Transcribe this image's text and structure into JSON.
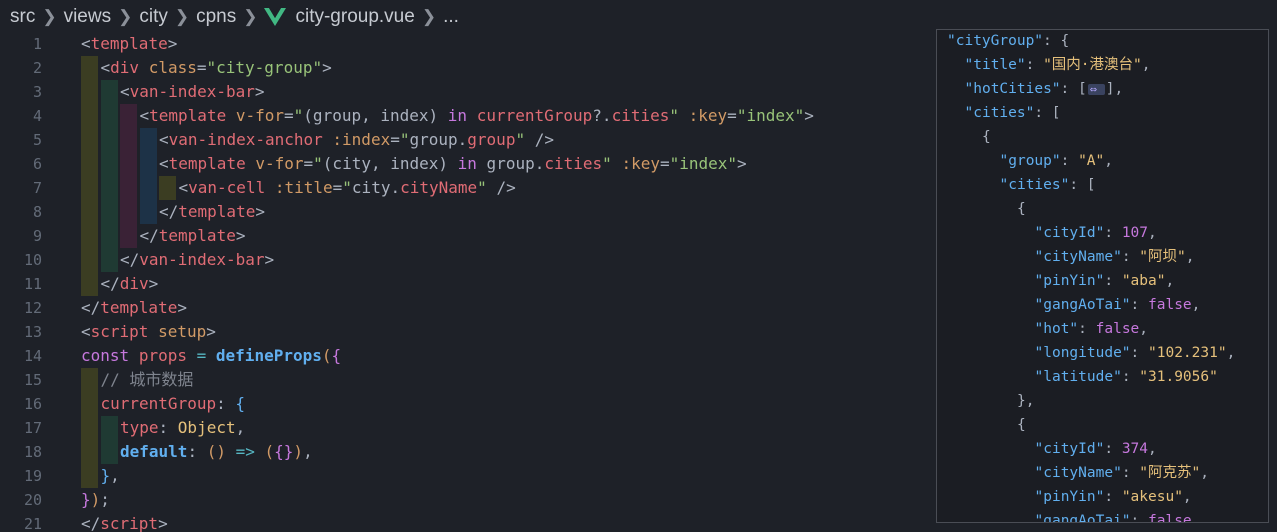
{
  "breadcrumb": {
    "items": [
      "src",
      "views",
      "city",
      "cpns"
    ],
    "file": "city-group.vue",
    "trail": "..."
  },
  "colors": {
    "vue_green": "#41b883",
    "background": "#1e2128"
  },
  "editor": {
    "lines": [
      {
        "n": "1",
        "indent": 0,
        "tokens": [
          [
            "br",
            "<"
          ],
          [
            "tag",
            "template"
          ],
          [
            "br",
            ">"
          ]
        ]
      },
      {
        "n": "2",
        "indent": 1,
        "tokens": [
          [
            "br",
            "<"
          ],
          [
            "tag",
            "div"
          ],
          [
            "plain",
            " "
          ],
          [
            "attr",
            "class"
          ],
          [
            "br",
            "="
          ],
          [
            "str",
            "\"city-group\""
          ],
          [
            "br",
            ">"
          ]
        ]
      },
      {
        "n": "3",
        "indent": 2,
        "tokens": [
          [
            "br",
            "<"
          ],
          [
            "tag",
            "van-index-bar"
          ],
          [
            "br",
            ">"
          ]
        ]
      },
      {
        "n": "4",
        "indent": 3,
        "tokens": [
          [
            "br",
            "<"
          ],
          [
            "tag",
            "template"
          ],
          [
            "plain",
            " "
          ],
          [
            "attr",
            "v-for"
          ],
          [
            "br",
            "="
          ],
          [
            "str",
            "\""
          ],
          [
            "plain",
            "(group, index) "
          ],
          [
            "key",
            "in"
          ],
          [
            "plain",
            " "
          ],
          [
            "var",
            "currentGroup"
          ],
          [
            "plain",
            "?."
          ],
          [
            "var",
            "cities"
          ],
          [
            "str",
            "\""
          ],
          [
            "plain",
            " "
          ],
          [
            "attr",
            ":key"
          ],
          [
            "br",
            "="
          ],
          [
            "str",
            "\"index\""
          ],
          [
            "br",
            ">"
          ]
        ]
      },
      {
        "n": "5",
        "indent": 4,
        "tokens": [
          [
            "br",
            "<"
          ],
          [
            "tag",
            "van-index-anchor"
          ],
          [
            "plain",
            " "
          ],
          [
            "attr",
            ":index"
          ],
          [
            "br",
            "="
          ],
          [
            "str",
            "\""
          ],
          [
            "plain",
            "group."
          ],
          [
            "var",
            "group"
          ],
          [
            "str",
            "\""
          ],
          [
            "plain",
            " "
          ],
          [
            "br",
            "/>"
          ]
        ]
      },
      {
        "n": "6",
        "indent": 4,
        "tokens": [
          [
            "br",
            "<"
          ],
          [
            "tag",
            "template"
          ],
          [
            "plain",
            " "
          ],
          [
            "attr",
            "v-for"
          ],
          [
            "br",
            "="
          ],
          [
            "str",
            "\""
          ],
          [
            "plain",
            "(city, index) "
          ],
          [
            "key",
            "in"
          ],
          [
            "plain",
            " group."
          ],
          [
            "var",
            "cities"
          ],
          [
            "str",
            "\""
          ],
          [
            "plain",
            " "
          ],
          [
            "attr",
            ":key"
          ],
          [
            "br",
            "="
          ],
          [
            "str",
            "\"index\""
          ],
          [
            "br",
            ">"
          ]
        ]
      },
      {
        "n": "7",
        "indent": 5,
        "tokens": [
          [
            "br",
            "<"
          ],
          [
            "tag",
            "van-cell"
          ],
          [
            "plain",
            " "
          ],
          [
            "attr",
            ":title"
          ],
          [
            "br",
            "="
          ],
          [
            "str",
            "\""
          ],
          [
            "plain",
            "city."
          ],
          [
            "var",
            "cityName"
          ],
          [
            "str",
            "\""
          ],
          [
            "plain",
            " "
          ],
          [
            "br",
            "/>"
          ]
        ]
      },
      {
        "n": "8",
        "indent": 4,
        "tokens": [
          [
            "br",
            "</"
          ],
          [
            "tag",
            "template"
          ],
          [
            "br",
            ">"
          ]
        ]
      },
      {
        "n": "9",
        "indent": 3,
        "tokens": [
          [
            "br",
            "</"
          ],
          [
            "tag",
            "template"
          ],
          [
            "br",
            ">"
          ]
        ]
      },
      {
        "n": "10",
        "indent": 2,
        "tokens": [
          [
            "br",
            "</"
          ],
          [
            "tag",
            "van-index-bar"
          ],
          [
            "br",
            ">"
          ]
        ]
      },
      {
        "n": "11",
        "indent": 1,
        "tokens": [
          [
            "br",
            "</"
          ],
          [
            "tag",
            "div"
          ],
          [
            "br",
            ">"
          ]
        ]
      },
      {
        "n": "12",
        "indent": 0,
        "tokens": [
          [
            "br",
            "</"
          ],
          [
            "tag",
            "template"
          ],
          [
            "br",
            ">"
          ]
        ]
      },
      {
        "n": "13",
        "indent": 0,
        "tokens": [
          [
            "br",
            "<"
          ],
          [
            "tag",
            "script"
          ],
          [
            "plain",
            " "
          ],
          [
            "attr",
            "setup"
          ],
          [
            "br",
            ">"
          ]
        ]
      },
      {
        "n": "14",
        "indent": 0,
        "tokens": [
          [
            "key",
            "const"
          ],
          [
            "plain",
            " "
          ],
          [
            "var",
            "props"
          ],
          [
            "plain",
            " "
          ],
          [
            "op",
            "="
          ],
          [
            "plain",
            " "
          ],
          [
            "fn",
            "defineProps"
          ],
          [
            "p1",
            "("
          ],
          [
            "p2",
            "{"
          ]
        ]
      },
      {
        "n": "15",
        "indent": 1,
        "tokens": [
          [
            "com",
            "// 城市数据"
          ]
        ]
      },
      {
        "n": "16",
        "indent": 1,
        "tokens": [
          [
            "prop",
            "currentGroup"
          ],
          [
            "plain",
            ": "
          ],
          [
            "p3",
            "{"
          ]
        ]
      },
      {
        "n": "17",
        "indent": 2,
        "tokens": [
          [
            "prop",
            "type"
          ],
          [
            "plain",
            ": "
          ],
          [
            "type",
            "Object"
          ],
          [
            "plain",
            ","
          ]
        ]
      },
      {
        "n": "18",
        "indent": 2,
        "tokens": [
          [
            "kw2",
            "default"
          ],
          [
            "plain",
            ": "
          ],
          [
            "p1",
            "()"
          ],
          [
            "plain",
            " "
          ],
          [
            "op",
            "=>"
          ],
          [
            "plain",
            " "
          ],
          [
            "p1",
            "("
          ],
          [
            "p2",
            "{}"
          ],
          [
            "p1",
            ")"
          ],
          [
            "plain",
            ","
          ]
        ]
      },
      {
        "n": "19",
        "indent": 1,
        "tokens": [
          [
            "p3",
            "}"
          ],
          [
            "plain",
            ","
          ]
        ]
      },
      {
        "n": "20",
        "indent": 0,
        "tokens": [
          [
            "p2",
            "}"
          ],
          [
            "p1",
            ")"
          ],
          [
            "plain",
            ";"
          ]
        ]
      },
      {
        "n": "21",
        "indent": 0,
        "tokens": [
          [
            "br",
            "</"
          ],
          [
            "tag",
            "script"
          ],
          [
            "br",
            ">"
          ]
        ]
      }
    ]
  },
  "json_panel": {
    "lines": [
      {
        "i": 0,
        "tokens": [
          [
            "key",
            "\"cityGroup\""
          ],
          [
            "pun",
            ": {"
          ]
        ]
      },
      {
        "i": 1,
        "tokens": [
          [
            "key",
            "\"title\""
          ],
          [
            "pun",
            ": "
          ],
          [
            "str",
            "\"国内·港澳台\""
          ],
          [
            "pun",
            ","
          ]
        ]
      },
      {
        "i": 1,
        "tokens": [
          [
            "key",
            "\"hotCities\""
          ],
          [
            "pun",
            ": ["
          ],
          [
            "fold",
            ""
          ],
          [
            "pun",
            "],"
          ]
        ]
      },
      {
        "i": 1,
        "tokens": [
          [
            "key",
            "\"cities\""
          ],
          [
            "pun",
            ": ["
          ]
        ]
      },
      {
        "i": 2,
        "tokens": [
          [
            "pun",
            "{"
          ]
        ]
      },
      {
        "i": 3,
        "tokens": [
          [
            "key",
            "\"group\""
          ],
          [
            "pun",
            ": "
          ],
          [
            "str",
            "\"A\""
          ],
          [
            "pun",
            ","
          ]
        ]
      },
      {
        "i": 3,
        "tokens": [
          [
            "key",
            "\"cities\""
          ],
          [
            "pun",
            ": ["
          ]
        ]
      },
      {
        "i": 4,
        "tokens": [
          [
            "pun",
            "{"
          ]
        ]
      },
      {
        "i": 5,
        "tokens": [
          [
            "key",
            "\"cityId\""
          ],
          [
            "pun",
            ": "
          ],
          [
            "num",
            "107"
          ],
          [
            "pun",
            ","
          ]
        ]
      },
      {
        "i": 5,
        "tokens": [
          [
            "key",
            "\"cityName\""
          ],
          [
            "pun",
            ": "
          ],
          [
            "str",
            "\"阿坝\""
          ],
          [
            "pun",
            ","
          ]
        ]
      },
      {
        "i": 5,
        "tokens": [
          [
            "key",
            "\"pinYin\""
          ],
          [
            "pun",
            ": "
          ],
          [
            "str",
            "\"aba\""
          ],
          [
            "pun",
            ","
          ]
        ]
      },
      {
        "i": 5,
        "tokens": [
          [
            "key",
            "\"gangAoTai\""
          ],
          [
            "pun",
            ": "
          ],
          [
            "bool",
            "false"
          ],
          [
            "pun",
            ","
          ]
        ]
      },
      {
        "i": 5,
        "tokens": [
          [
            "key",
            "\"hot\""
          ],
          [
            "pun",
            ": "
          ],
          [
            "bool",
            "false"
          ],
          [
            "pun",
            ","
          ]
        ]
      },
      {
        "i": 5,
        "tokens": [
          [
            "key",
            "\"longitude\""
          ],
          [
            "pun",
            ": "
          ],
          [
            "str",
            "\"102.231\""
          ],
          [
            "pun",
            ","
          ]
        ]
      },
      {
        "i": 5,
        "tokens": [
          [
            "key",
            "\"latitude\""
          ],
          [
            "pun",
            ": "
          ],
          [
            "str",
            "\"31.9056\""
          ]
        ]
      },
      {
        "i": 4,
        "tokens": [
          [
            "pun",
            "},"
          ]
        ]
      },
      {
        "i": 4,
        "tokens": [
          [
            "pun",
            "{"
          ]
        ]
      },
      {
        "i": 5,
        "tokens": [
          [
            "key",
            "\"cityId\""
          ],
          [
            "pun",
            ": "
          ],
          [
            "num",
            "374"
          ],
          [
            "pun",
            ","
          ]
        ]
      },
      {
        "i": 5,
        "tokens": [
          [
            "key",
            "\"cityName\""
          ],
          [
            "pun",
            ": "
          ],
          [
            "str",
            "\"阿克苏\""
          ],
          [
            "pun",
            ","
          ]
        ]
      },
      {
        "i": 5,
        "tokens": [
          [
            "key",
            "\"pinYin\""
          ],
          [
            "pun",
            ": "
          ],
          [
            "str",
            "\"akesu\""
          ],
          [
            "pun",
            ","
          ]
        ]
      },
      {
        "i": 5,
        "tokens": [
          [
            "key",
            "\"gangAoTai\""
          ],
          [
            "pun",
            ": "
          ],
          [
            "bool",
            "false"
          ],
          [
            "pun",
            ","
          ]
        ]
      }
    ]
  }
}
